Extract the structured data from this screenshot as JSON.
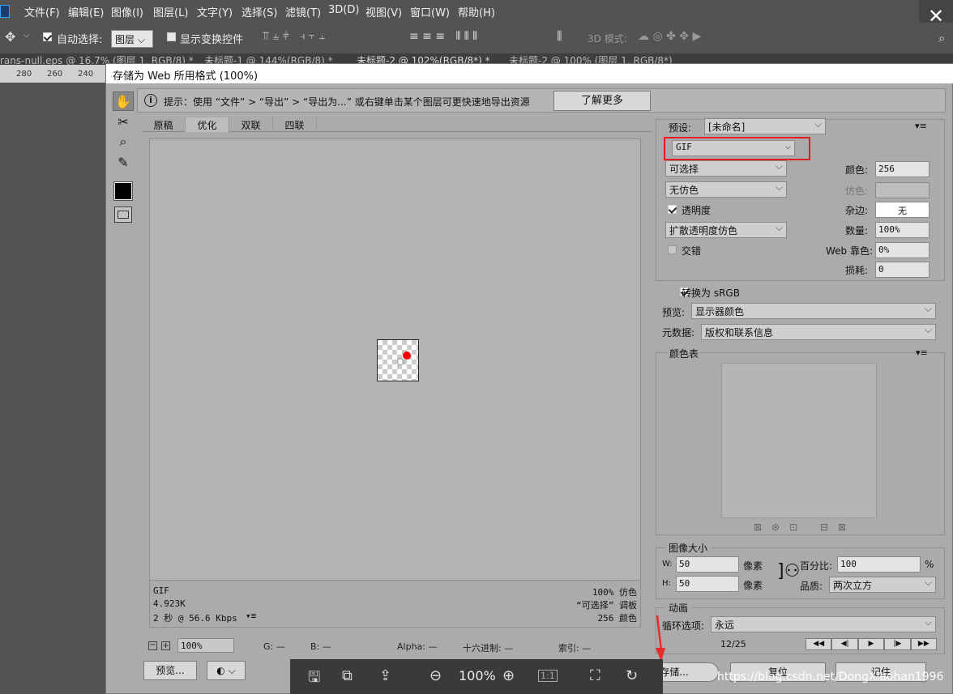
{
  "menubar": {
    "items": [
      "文件(F)",
      "编辑(E)",
      "图像(I)",
      "图层(L)",
      "文字(Y)",
      "选择(S)",
      "滤镜(T)",
      "3D(D)",
      "视图(V)",
      "窗口(W)",
      "帮助(H)"
    ]
  },
  "options": {
    "auto_select_label": "自动选择:",
    "layer_select": "图层",
    "show_transform_label": "显示变换控件",
    "mode_3d_label": "3D 模式:"
  },
  "doc_tabs": [
    "rans-null.eps @ 16.7% (图层 1, RGB/8) *",
    "未标题-1 @ 144%(RGB/8) *",
    "未标题-2 @ 102%(RGB/8*) *",
    "未标题-2 @ 100% (图层 1, RGB/8*)"
  ],
  "ruler": [
    "280",
    "260",
    "240"
  ],
  "dialog": {
    "title": "存储为 Web 所用格式 (100%)",
    "tip": "提示：使用 “文件” > “导出” > “导出为...” 或右键单击某个图层可更快速地导出资源",
    "learn_more": "了解更多",
    "tabs": [
      "原稿",
      "优化",
      "双联",
      "四联"
    ],
    "info": {
      "format": "GIF",
      "size": "4.923K",
      "time": "2 秒 @ 56.6 Kbps",
      "dither": "100% 仿色",
      "palette": "“可选择” 调板",
      "colors": "256 颜色"
    },
    "status": {
      "zoom": "100%",
      "g": "G: —",
      "b": "B: —",
      "alpha": "Alpha: —",
      "hex": "十六进制: —",
      "index": "索引: —"
    },
    "preview_button": "预览...",
    "settings": {
      "preset_label": "预设:",
      "preset_value": "[未命名]",
      "format": "GIF",
      "reduction": "可选择",
      "colors_label": "颜色:",
      "colors_value": "256",
      "dither_algo": "无仿色",
      "dither_label": "仿色:",
      "transparency_label": "透明度",
      "matte_label": "杂边:",
      "matte_value": "无",
      "trans_dither": "扩散透明度仿色",
      "amount_label": "数量:",
      "amount_value": "100%",
      "interlace_label": "交错",
      "websnap_label": "Web 靠色:",
      "websnap_value": "0%",
      "lossy_label": "损耗:",
      "lossy_value": "0",
      "convert_srgb_label": "转换为 sRGB",
      "preview_label": "预览:",
      "preview_value": "显示器颜色",
      "metadata_label": "元数据:",
      "metadata_value": "版权和联系信息"
    },
    "color_table_title": "颜色表",
    "image_size": {
      "title": "图像大小",
      "w_label": "W:",
      "w_value": "50",
      "h_label": "H:",
      "h_value": "50",
      "unit": "像素",
      "percent_label": "百分比:",
      "percent_value": "100",
      "percent_sign": "%",
      "quality_label": "品质:",
      "quality_value": "两次立方"
    },
    "animation": {
      "title": "动画",
      "loop_label": "循环选项:",
      "loop_value": "永远",
      "frame": "12/25"
    },
    "buttons": {
      "save": "存储...",
      "reset": "复位",
      "remember": "记住"
    }
  },
  "floatbar": {
    "zoom": "100%"
  },
  "watermark": "https://blog.csdn.net/DongXiaohan1996",
  "colors": {
    "highlight_box": "#e02020",
    "red_dot": "#ff0000",
    "accent_arrow": "#e82b2b"
  }
}
